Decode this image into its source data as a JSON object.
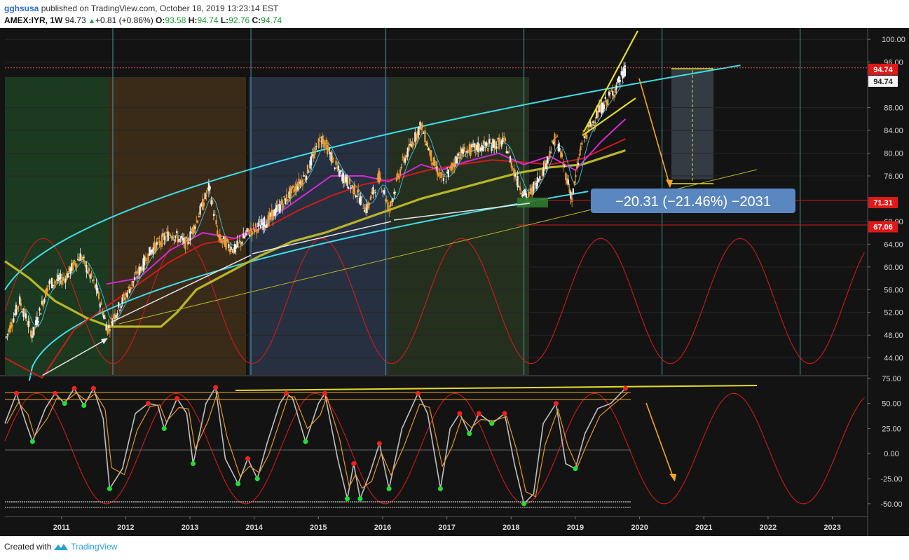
{
  "header": {
    "author": "gghsusa",
    "published": "published on TradingView.com, October 18, 2019 13:23:14 EST",
    "symbol": "AMEX:IYR, 1W",
    "last": "94.73",
    "change": "+0.81 (+0.86%)",
    "o_label": "O:",
    "o_value": "93.58",
    "h_label": "H:",
    "h_value": "94.74",
    "l_label": "L:",
    "l_value": "92.76",
    "c_label": "C:",
    "c_value": "94.74"
  },
  "footer": {
    "created_with": "Created with",
    "brand": "TradingView"
  },
  "colors": {
    "background": "#131313",
    "up": "#f2f2f2",
    "down": "#f0a030",
    "cyan": "#3fdde8",
    "yellow": "#e3dc2a",
    "olive": "#b7b52a",
    "red": "#d11a1a",
    "magenta": "#d42ad4",
    "teal": "#3fb8c8",
    "arrow_orange": "#f5a623",
    "label_blue": "#5b87c0"
  },
  "chart_data": {
    "type": "candlestick",
    "price_axis": {
      "ticks": [
        "100.00",
        "96.00",
        "88.00",
        "84.00",
        "80.00",
        "76.00",
        "68.00",
        "64.00",
        "60.00",
        "56.00",
        "52.00",
        "48.00",
        "44.00"
      ],
      "ylim": [
        41,
        102
      ]
    },
    "x_axis": {
      "tick_labels": [
        "2011",
        "2012",
        "2013",
        "2014",
        "2015",
        "2016",
        "2017",
        "2018",
        "2019",
        "2020",
        "2021",
        "2022",
        "2023"
      ],
      "xlim": [
        2010.12,
        2023.55
      ]
    },
    "price_labels": [
      {
        "value": "94.74",
        "style": "red"
      },
      {
        "value": "94.74",
        "style": "white"
      },
      {
        "value": "71.31",
        "style": "red"
      },
      {
        "value": "67.06",
        "style": "red"
      }
    ],
    "measure_label": "−20.31 (−21.46%) −2031",
    "price_path": [
      [
        2010.12,
        47
      ],
      [
        2010.35,
        54
      ],
      [
        2010.55,
        48
      ],
      [
        2010.8,
        57
      ],
      [
        2011.05,
        58
      ],
      [
        2011.3,
        62
      ],
      [
        2011.55,
        56
      ],
      [
        2011.72,
        49
      ],
      [
        2011.85,
        52
      ],
      [
        2012.1,
        57
      ],
      [
        2012.4,
        63
      ],
      [
        2012.7,
        66
      ],
      [
        2012.95,
        64
      ],
      [
        2013.1,
        68
      ],
      [
        2013.3,
        74
      ],
      [
        2013.45,
        65
      ],
      [
        2013.7,
        63
      ],
      [
        2013.9,
        66
      ],
      [
        2014.2,
        68
      ],
      [
        2014.5,
        72
      ],
      [
        2014.8,
        76
      ],
      [
        2015.05,
        83
      ],
      [
        2015.3,
        77
      ],
      [
        2015.6,
        73
      ],
      [
        2015.75,
        70
      ],
      [
        2015.95,
        76
      ],
      [
        2016.1,
        70
      ],
      [
        2016.3,
        78
      ],
      [
        2016.6,
        85
      ],
      [
        2016.8,
        78
      ],
      [
        2016.95,
        75
      ],
      [
        2017.2,
        80
      ],
      [
        2017.5,
        81
      ],
      [
        2017.9,
        82
      ],
      [
        2018.1,
        75
      ],
      [
        2018.25,
        72
      ],
      [
        2018.5,
        77
      ],
      [
        2018.7,
        83
      ],
      [
        2018.95,
        72
      ],
      [
        2019.1,
        82
      ],
      [
        2019.35,
        87
      ],
      [
        2019.6,
        91
      ],
      [
        2019.78,
        94.7
      ]
    ],
    "moving_averages": [
      {
        "color": "#b7b52a",
        "points": [
          [
            2010.12,
            61
          ],
          [
            2010.5,
            58
          ],
          [
            2010.9,
            54
          ],
          [
            2011.4,
            51
          ],
          [
            2011.75,
            49.5
          ],
          [
            2012.2,
            49.5
          ],
          [
            2012.55,
            49.5
          ],
          [
            2012.8,
            52
          ],
          [
            2013.1,
            56
          ],
          [
            2013.6,
            59
          ],
          [
            2014.1,
            62
          ],
          [
            2014.6,
            64.5
          ],
          [
            2015.1,
            66
          ],
          [
            2015.6,
            68
          ],
          [
            2016.1,
            70
          ],
          [
            2016.6,
            72
          ],
          [
            2017.1,
            73.5
          ],
          [
            2017.6,
            75
          ],
          [
            2018.1,
            76.5
          ],
          [
            2018.6,
            77.5
          ],
          [
            2019.1,
            78
          ],
          [
            2019.78,
            80.5
          ]
        ]
      },
      {
        "color": "#d11a1a",
        "points": [
          [
            2010.12,
            44
          ],
          [
            2010.7,
            40.5
          ],
          [
            2011.2,
            49
          ],
          [
            2011.7,
            53
          ],
          [
            2012.2,
            57
          ],
          [
            2012.7,
            61
          ],
          [
            2013.2,
            64
          ],
          [
            2013.7,
            65
          ],
          [
            2014.2,
            67
          ],
          [
            2014.7,
            70
          ],
          [
            2015.2,
            72.5
          ],
          [
            2015.7,
            74.5
          ],
          [
            2016.2,
            75.5
          ],
          [
            2016.7,
            77
          ],
          [
            2017.2,
            78
          ],
          [
            2017.7,
            78.8
          ],
          [
            2018.1,
            78.5
          ],
          [
            2018.6,
            78
          ],
          [
            2019.1,
            79
          ],
          [
            2019.78,
            82.5
          ]
        ]
      },
      {
        "color": "#d42ad4",
        "points": [
          [
            2011.7,
            57
          ],
          [
            2012.2,
            58
          ],
          [
            2012.7,
            63
          ],
          [
            2013.2,
            66
          ],
          [
            2013.7,
            65
          ],
          [
            2014.2,
            68
          ],
          [
            2014.7,
            72
          ],
          [
            2015.2,
            76
          ],
          [
            2015.7,
            76
          ],
          [
            2016.1,
            75
          ],
          [
            2016.6,
            78
          ],
          [
            2016.9,
            77
          ],
          [
            2017.3,
            78.5
          ],
          [
            2017.8,
            80
          ],
          [
            2018.2,
            78
          ],
          [
            2018.6,
            79.5
          ],
          [
            2019.0,
            77
          ],
          [
            2019.4,
            82
          ],
          [
            2019.78,
            86
          ]
        ]
      }
    ],
    "cycle_lines_years": [
      2011.8,
      2013.95,
      2016.05,
      2018.2,
      2020.35,
      2022.5
    ],
    "rsi_panel": {
      "ticks": [
        "75.00",
        "50.00",
        "25.00",
        "0.00",
        "-25.00",
        "-50.00"
      ],
      "ylim": [
        -62,
        77
      ],
      "points": [
        [
          2010.12,
          30
        ],
        [
          2010.3,
          60
        ],
        [
          2010.45,
          30
        ],
        [
          2010.55,
          12
        ],
        [
          2010.75,
          45
        ],
        [
          2010.9,
          60
        ],
        [
          2011.05,
          50
        ],
        [
          2011.2,
          65
        ],
        [
          2011.35,
          48
        ],
        [
          2011.5,
          65
        ],
        [
          2011.65,
          35
        ],
        [
          2011.75,
          -35
        ],
        [
          2011.95,
          -15
        ],
        [
          2012.15,
          40
        ],
        [
          2012.35,
          50
        ],
        [
          2012.5,
          48
        ],
        [
          2012.6,
          25
        ],
        [
          2012.8,
          55
        ],
        [
          2012.95,
          40
        ],
        [
          2013.05,
          -10
        ],
        [
          2013.25,
          50
        ],
        [
          2013.4,
          66
        ],
        [
          2013.55,
          -5
        ],
        [
          2013.75,
          -30
        ],
        [
          2013.9,
          -5
        ],
        [
          2014.05,
          -25
        ],
        [
          2014.2,
          10
        ],
        [
          2014.4,
          50
        ],
        [
          2014.5,
          60
        ],
        [
          2014.6,
          55
        ],
        [
          2014.8,
          12
        ],
        [
          2015.0,
          50
        ],
        [
          2015.1,
          60
        ],
        [
          2015.3,
          -5
        ],
        [
          2015.45,
          -45
        ],
        [
          2015.55,
          -10
        ],
        [
          2015.65,
          -45
        ],
        [
          2015.8,
          -20
        ],
        [
          2015.95,
          10
        ],
        [
          2016.1,
          -35
        ],
        [
          2016.3,
          25
        ],
        [
          2016.55,
          60
        ],
        [
          2016.7,
          40
        ],
        [
          2016.9,
          -35
        ],
        [
          2017.05,
          25
        ],
        [
          2017.2,
          40
        ],
        [
          2017.35,
          20
        ],
        [
          2017.5,
          40
        ],
        [
          2017.7,
          30
        ],
        [
          2017.9,
          40
        ],
        [
          2018.05,
          -10
        ],
        [
          2018.2,
          -50
        ],
        [
          2018.35,
          -40
        ],
        [
          2018.5,
          30
        ],
        [
          2018.7,
          50
        ],
        [
          2018.85,
          -10
        ],
        [
          2019.0,
          -15
        ],
        [
          2019.15,
          20
        ],
        [
          2019.35,
          45
        ],
        [
          2019.55,
          50
        ],
        [
          2019.78,
          65
        ]
      ]
    }
  }
}
